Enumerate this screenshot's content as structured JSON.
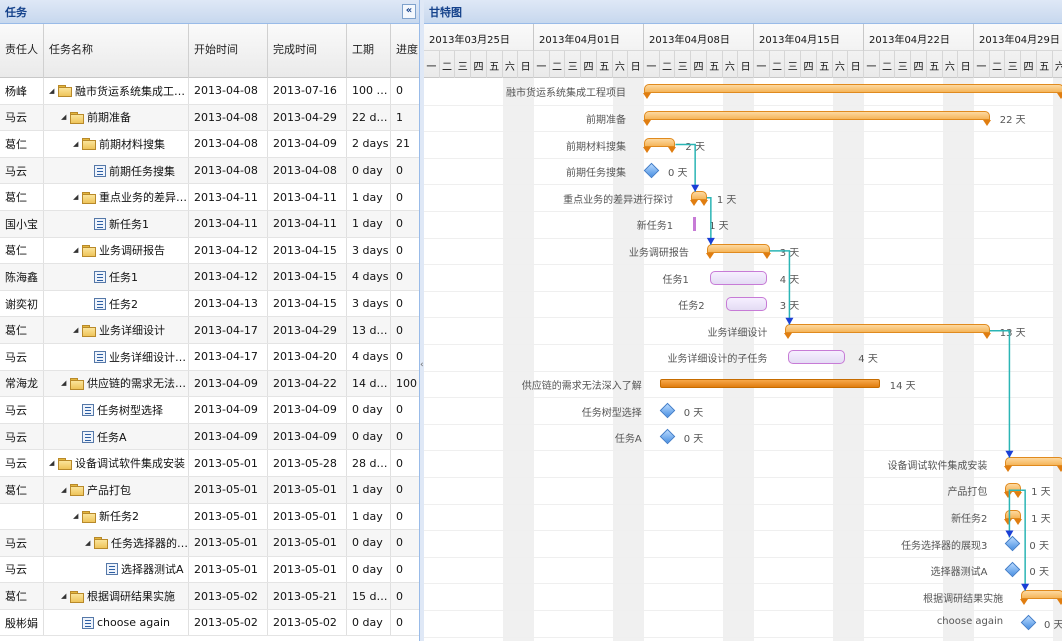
{
  "left_panel": {
    "title": "任务",
    "collapse_icon": "«"
  },
  "columns": [
    "责任人",
    "任务名称",
    "开始时间",
    "完成时间",
    "工期",
    "进度"
  ],
  "tasks": [
    {
      "owner": "杨峰",
      "name": "融市货运系统集成工程项目",
      "start": "2013-04-08",
      "end": "2013-07-16",
      "duration": "100 d...",
      "progress": "0",
      "level": 0,
      "type": "folder"
    },
    {
      "owner": "马云",
      "name": "前期准备",
      "start": "2013-04-08",
      "end": "2013-04-29",
      "duration": "22 days",
      "progress": "1",
      "level": 1,
      "type": "folder"
    },
    {
      "owner": "葛仁",
      "name": "前期材料搜集",
      "start": "2013-04-08",
      "end": "2013-04-09",
      "duration": "2 days",
      "progress": "21",
      "level": 2,
      "type": "folder"
    },
    {
      "owner": "马云",
      "name": "前期任务搜集",
      "start": "2013-04-08",
      "end": "2013-04-08",
      "duration": "0 day",
      "progress": "0",
      "level": 3,
      "type": "task"
    },
    {
      "owner": "葛仁",
      "name": "重点业务的差异进行探讨",
      "start": "2013-04-11",
      "end": "2013-04-11",
      "duration": "1 day",
      "progress": "0",
      "level": 2,
      "type": "folder"
    },
    {
      "owner": "国小宝",
      "name": "新任务1",
      "start": "2013-04-11",
      "end": "2013-04-11",
      "duration": "1 day",
      "progress": "0",
      "level": 3,
      "type": "task"
    },
    {
      "owner": "葛仁",
      "name": "业务调研报告",
      "start": "2013-04-12",
      "end": "2013-04-15",
      "duration": "3 days",
      "progress": "0",
      "level": 2,
      "type": "folder"
    },
    {
      "owner": "陈海鑫",
      "name": "任务1",
      "start": "2013-04-12",
      "end": "2013-04-15",
      "duration": "4 days",
      "progress": "0",
      "level": 3,
      "type": "task"
    },
    {
      "owner": "谢奕初",
      "name": "任务2",
      "start": "2013-04-13",
      "end": "2013-04-15",
      "duration": "3 days",
      "progress": "0",
      "level": 3,
      "type": "task"
    },
    {
      "owner": "葛仁",
      "name": "业务详细设计",
      "start": "2013-04-17",
      "end": "2013-04-29",
      "duration": "13 days",
      "progress": "0",
      "level": 2,
      "type": "folder"
    },
    {
      "owner": "马云",
      "name": "业务详细设计的子...",
      "start": "2013-04-17",
      "end": "2013-04-20",
      "duration": "4 days",
      "progress": "0",
      "level": 3,
      "type": "task"
    },
    {
      "owner": "常海龙",
      "name": "供应链的需求无法深入...",
      "start": "2013-04-09",
      "end": "2013-04-22",
      "duration": "14 days",
      "progress": "100",
      "level": 1,
      "type": "folder"
    },
    {
      "owner": "马云",
      "name": "任务树型选择",
      "start": "2013-04-09",
      "end": "2013-04-09",
      "duration": "0 day",
      "progress": "0",
      "level": 2,
      "type": "task"
    },
    {
      "owner": "马云",
      "name": "任务A",
      "start": "2013-04-09",
      "end": "2013-04-09",
      "duration": "0 day",
      "progress": "0",
      "level": 2,
      "type": "task"
    },
    {
      "owner": "马云",
      "name": "设备调试软件集成安装",
      "start": "2013-05-01",
      "end": "2013-05-28",
      "duration": "28 days",
      "progress": "0",
      "level": 0,
      "type": "folder"
    },
    {
      "owner": "葛仁",
      "name": "产品打包",
      "start": "2013-05-01",
      "end": "2013-05-01",
      "duration": "1 day",
      "progress": "0",
      "level": 1,
      "type": "folder"
    },
    {
      "owner": "",
      "name": "新任务2",
      "start": "2013-05-01",
      "end": "2013-05-01",
      "duration": "1 day",
      "progress": "0",
      "level": 2,
      "type": "folder"
    },
    {
      "owner": "马云",
      "name": "任务选择器的展...",
      "start": "2013-05-01",
      "end": "2013-05-01",
      "duration": "0 day",
      "progress": "0",
      "level": 3,
      "type": "folder"
    },
    {
      "owner": "马云",
      "name": "选择器测试A",
      "start": "2013-05-01",
      "end": "2013-05-01",
      "duration": "0 day",
      "progress": "0",
      "level": 4,
      "type": "task"
    },
    {
      "owner": "葛仁",
      "name": "根据调研结果实施",
      "start": "2013-05-02",
      "end": "2013-05-21",
      "duration": "15 days",
      "progress": "0",
      "level": 1,
      "type": "folder"
    },
    {
      "owner": "殷彬娟",
      "name": "choose again",
      "start": "2013-05-02",
      "end": "2013-05-02",
      "duration": "0 day",
      "progress": "0",
      "level": 2,
      "type": "task"
    }
  ],
  "gantt_panel": {
    "title": "甘特图"
  },
  "weeks": [
    "2013年03月25日",
    "2013年04月01日",
    "2013年04月08日",
    "2013年04月15日",
    "2013年04月22日",
    "2013年04月29日"
  ],
  "weekdays": [
    "一",
    "二",
    "三",
    "四",
    "五",
    "六",
    "日"
  ],
  "gantt_rows": [
    {
      "label": "融市货运系统集成工程项目",
      "kind": "summary",
      "dur": ""
    },
    {
      "label": "前期准备",
      "kind": "summary",
      "dur": "22 天"
    },
    {
      "label": "前期材料搜集",
      "kind": "summary",
      "dur": "2 天"
    },
    {
      "label": "前期任务搜集",
      "kind": "milestone",
      "dur": "0 天"
    },
    {
      "label": "重点业务的差异进行探讨",
      "kind": "summary",
      "dur": "1 天"
    },
    {
      "label": "新任务1",
      "kind": "mini",
      "dur": "1 天"
    },
    {
      "label": "业务调研报告",
      "kind": "summary",
      "dur": "3 天"
    },
    {
      "label": "任务1",
      "kind": "task",
      "dur": "4 天"
    },
    {
      "label": "任务2",
      "kind": "task",
      "dur": "3 天"
    },
    {
      "label": "业务详细设计",
      "kind": "summary",
      "dur": "13 天"
    },
    {
      "label": "业务详细设计的子任务",
      "kind": "task",
      "dur": "4 天"
    },
    {
      "label": "供应链的需求无法深入了解",
      "kind": "progress",
      "dur": "14 天"
    },
    {
      "label": "任务树型选择",
      "kind": "milestone",
      "dur": "0 天"
    },
    {
      "label": "任务A",
      "kind": "milestone",
      "dur": "0 天"
    },
    {
      "label": "设备调试软件集成安装",
      "kind": "summary",
      "dur": ""
    },
    {
      "label": "产品打包",
      "kind": "summary",
      "dur": "1 天"
    },
    {
      "label": "新任务2",
      "kind": "summary",
      "dur": "1 天"
    },
    {
      "label": "任务选择器的展现3",
      "kind": "milestone",
      "dur": "0 天"
    },
    {
      "label": "选择器测试A",
      "kind": "milestone",
      "dur": "0 天"
    },
    {
      "label": "根据调研结果实施",
      "kind": "summary",
      "dur": ""
    },
    {
      "label": "choose again",
      "kind": "milestone",
      "dur": "0 天"
    }
  ],
  "colors": {
    "summary": "#f5b55a",
    "progress": "#e07d10",
    "task_border": "#c77bd6",
    "milestone": "#4a90e2",
    "link": "#2bb5b5",
    "arrow": "#1a3fd6"
  }
}
